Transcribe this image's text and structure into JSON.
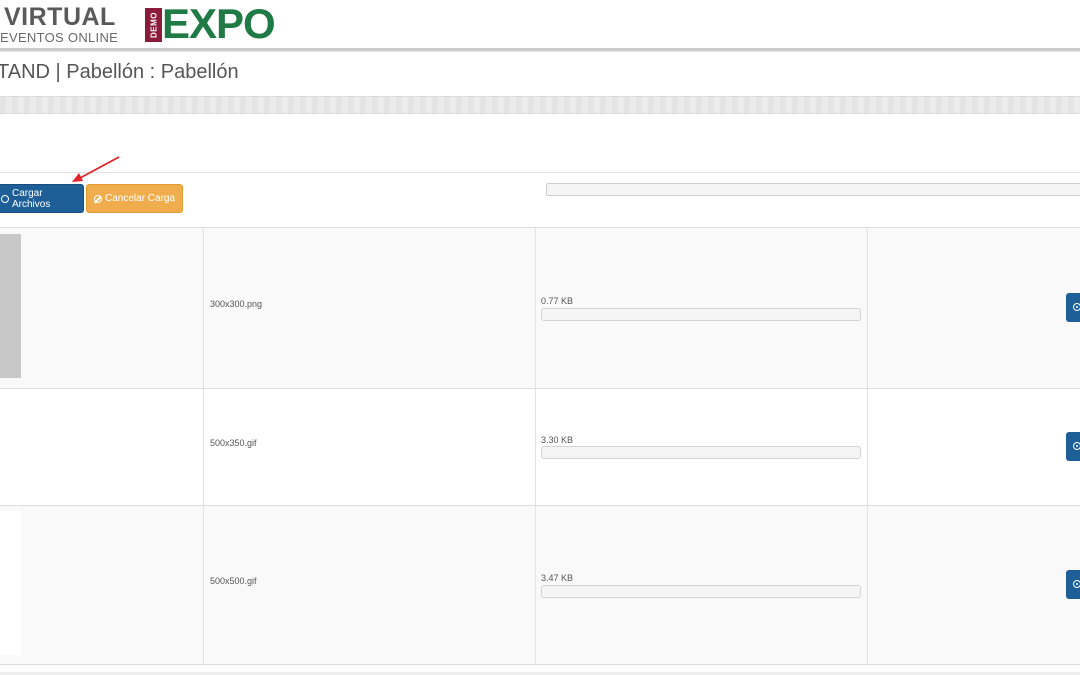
{
  "header": {
    "brand_name": "VIRTUAL",
    "brand_tagline": "EVENTOS ONLINE",
    "demo_label": "DEMO",
    "expo_label": "EXPO"
  },
  "page": {
    "title": "TAND | Pabellón : Pabellón"
  },
  "toolbar": {
    "upload_label": "Cargar Archivos",
    "cancel_label": "Cancelar Carga"
  },
  "colors": {
    "primary": "#1e5f98",
    "warning": "#efad4d",
    "brand_green": "#1f7a45",
    "brand_maroon": "#8a1c3a",
    "annotation_arrow": "#e0242a"
  },
  "files": [
    {
      "name": "300x300.png",
      "size": "0.77 KB"
    },
    {
      "name": "500x350.gif",
      "size": "3.30 KB"
    },
    {
      "name": "500x500.gif",
      "size": "3.47 KB"
    }
  ]
}
